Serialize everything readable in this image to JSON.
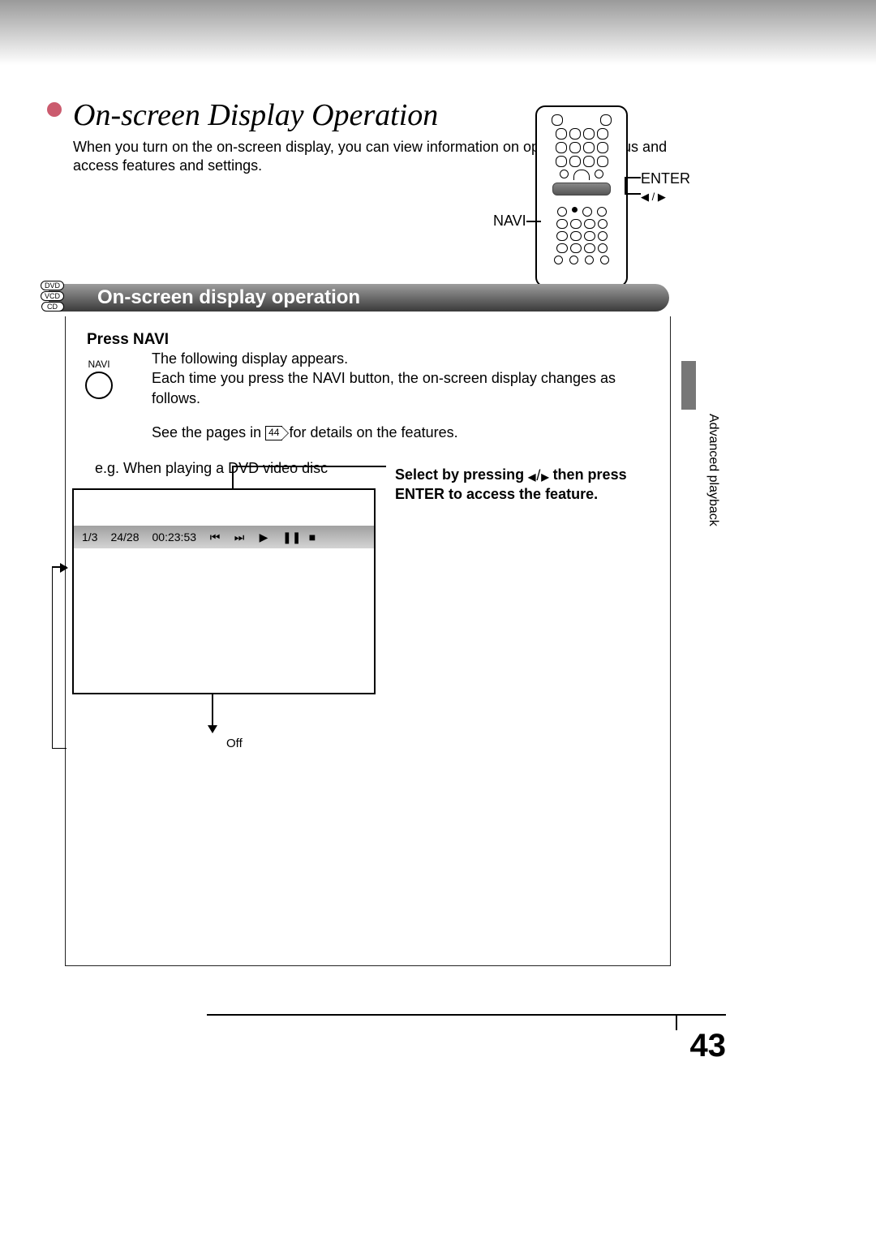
{
  "title": "On-screen Display Operation",
  "intro": "When you turn on the on-screen display, you can view information on operational status and access features and settings.",
  "remote_labels": {
    "enter": "ENTER",
    "navi": "NAVI"
  },
  "badges": [
    "DVD",
    "VCD",
    "CD"
  ],
  "section_heading": "On-screen display operation",
  "step": {
    "heading": "Press NAVI",
    "navi_button": "NAVI",
    "line1": "The following display appears.",
    "line2": "Each time you press the NAVI button, the on-screen display changes as follows.",
    "ref_prefix": "See the pages in ",
    "ref_page": "44",
    "ref_suffix": " for details on the features.",
    "example": "e.g. When playing a DVD video disc",
    "instruction_l1": "Select by pressing ",
    "instruction_l2": " then press",
    "instruction_l3": "ENTER to access the feature."
  },
  "osd": {
    "title_counter": "1/3",
    "chapter_counter": "24/28",
    "time": "00:23:53",
    "icons": [
      "⏮",
      "⏭",
      "▶",
      "❚❚",
      "■"
    ]
  },
  "off_label": "Off",
  "side_text": "Advanced playback",
  "page_number": "43"
}
